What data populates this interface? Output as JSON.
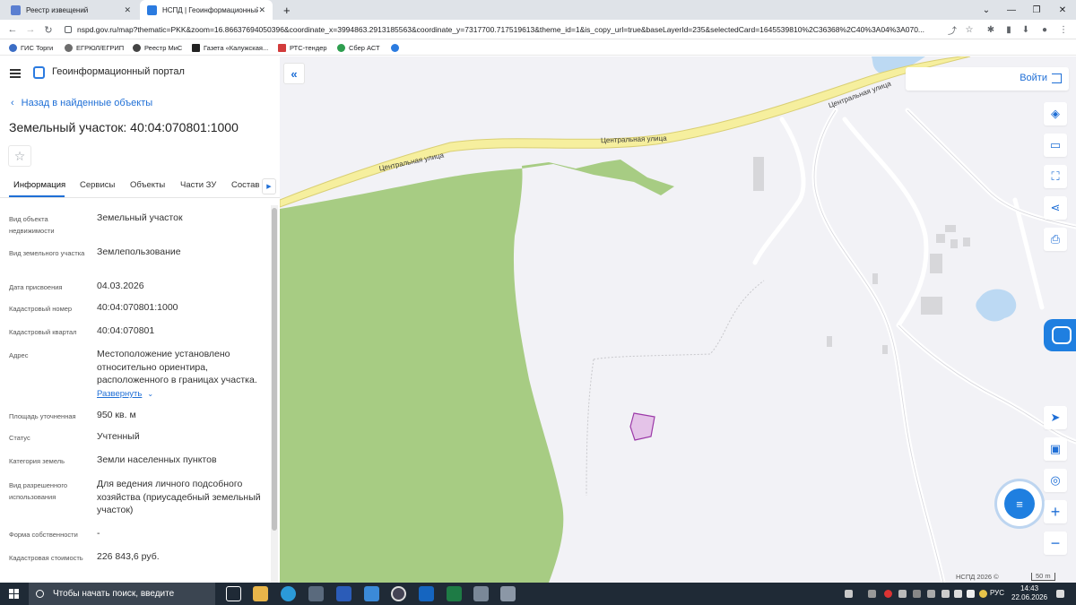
{
  "browser": {
    "tabs": [
      {
        "title": "Реестр извещений",
        "active": false
      },
      {
        "title": "НСПД | Геоинформационный п",
        "active": true
      }
    ],
    "new_tab": "+",
    "url": "nspd.gov.ru/map?thematic=PKK&zoom=16.86637694050396&coordinate_x=3994863.2913185563&coordinate_y=7317700.717519613&theme_id=1&is_copy_url=true&baseLayerId=235&selectedCard=1645539810%2C36368%2C40%3A04%3A070...",
    "bookmarks": [
      "ГИС Торги",
      "ЕГРЮЛ/ЕГРИП",
      "Реестр МиС",
      "Газета «Калужская...",
      "РТС-тендер",
      "Сбер АСТ"
    ]
  },
  "panel": {
    "portal_title": "Геоинформационный портал",
    "back_label": "Назад в найденные объекты",
    "object_title": "Земельный участок: 40:04:070801:1000",
    "tabs": [
      "Информация",
      "Сервисы",
      "Объекты",
      "Части ЗУ",
      "Состав"
    ],
    "rows": [
      {
        "label": "Вид объекта недвижимости",
        "value": "Земельный участок"
      },
      {
        "label": "Вид земельного участка",
        "value": "Землепользование"
      },
      {
        "label": "Дата присвоения",
        "value": "04.03.2026"
      },
      {
        "label": "Кадастровый номер",
        "value": "40:04:070801:1000"
      },
      {
        "label": "Кадастровый квартал",
        "value": "40:04:070801"
      },
      {
        "label": "Адрес",
        "value": "Местоположение установлено относительно ориентира, расположенного в границах участка."
      },
      {
        "label": "Площадь уточненная",
        "value": "950 кв. м"
      },
      {
        "label": "Статус",
        "value": "Учтенный"
      },
      {
        "label": "Категория земель",
        "value": "Земли населенных пунктов"
      },
      {
        "label": "Вид разрешенного использования",
        "value": "Для ведения личного подсобного хозяйства (приусадебный земельный участок)"
      },
      {
        "label": "Форма собственности",
        "value": "-"
      },
      {
        "label": "Кадастровая стоимость",
        "value": "226 843,6 руб."
      }
    ],
    "expand_label": "Развернуть"
  },
  "map": {
    "road_label": "Центральная улица",
    "login_label": "Войти",
    "attribution": "НСПД 2026 ©",
    "scale_label": "50 m",
    "colors": {
      "road": "#f6ef9e",
      "road_edge": "#d9cf74",
      "forest": "#a7cc83",
      "parcel_fill": "#e4c3e8",
      "parcel_stroke": "#9c3aa8",
      "water": "#bcd9f3",
      "accent": "#1f6fd6"
    }
  },
  "taskbar": {
    "search_placeholder": "Чтобы начать поиск, введите",
    "language": "РУС",
    "time": "14:43",
    "date": "22.06.2026"
  }
}
